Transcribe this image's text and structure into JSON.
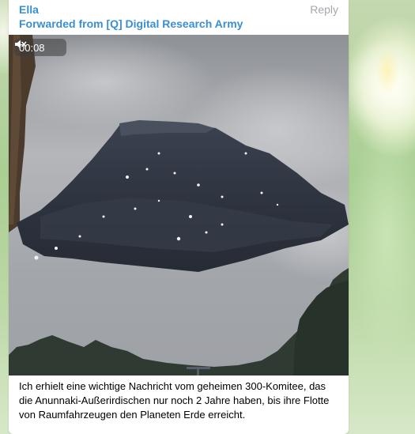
{
  "message": {
    "sender": "Ella",
    "reply_label": "Reply",
    "forwarded": "Forwarded from [Q] Digital Research Army",
    "caption": "Ich erhielt eine wichtige Nachricht vom geheimen 300-Komitee, das die Anunnaki-Außerirdischen nur noch 2 Jahre haben, bis ihre Flotte von Raumfahrzeugen den Planeten Erde erreicht."
  },
  "video": {
    "duration": "00:08",
    "muted_icon": "speaker-muted-icon"
  },
  "colors": {
    "accent": "#3a8fd1",
    "muted_text": "#a2a8ad",
    "background": "#b9d6a4"
  }
}
